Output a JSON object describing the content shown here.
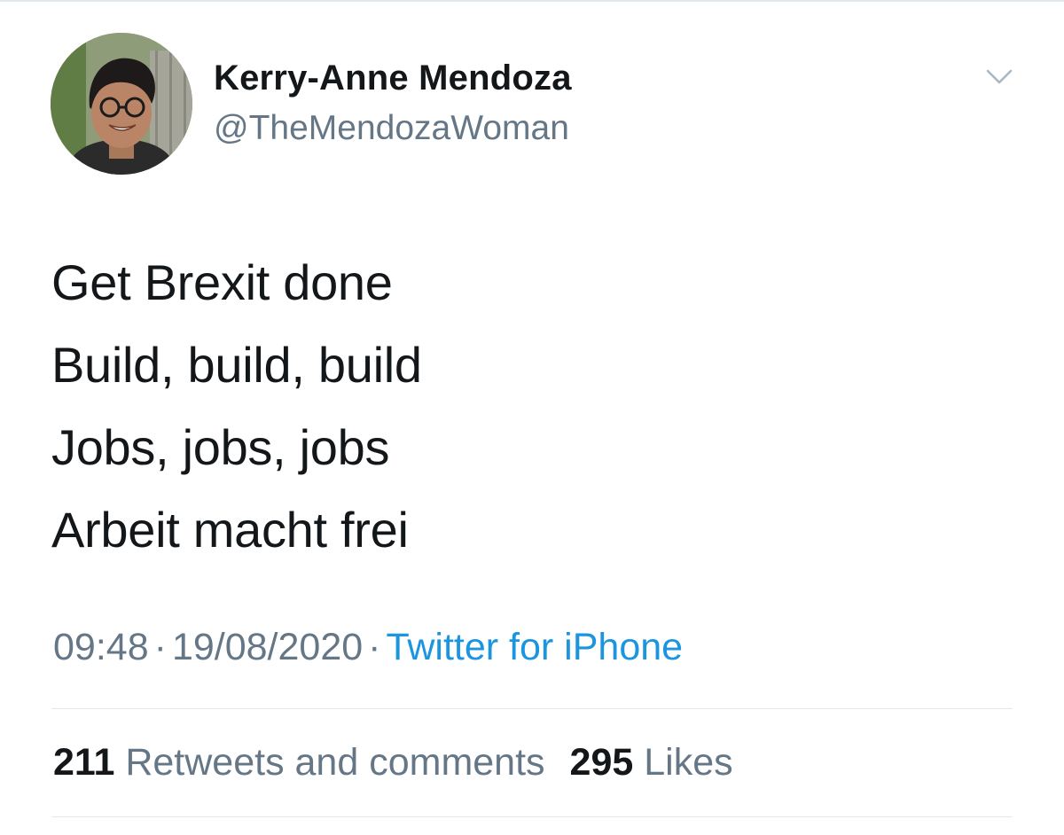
{
  "tweet": {
    "author": {
      "display_name": "Kerry-Anne Mendoza",
      "handle": "@TheMendozaWoman",
      "avatar_icon": "profile-photo"
    },
    "menu_icon": "chevron-down-icon",
    "lines": [
      "Get Brexit done",
      "Build, build, build",
      "Jobs, jobs, jobs",
      "Arbeit macht frei"
    ],
    "time": "09:48",
    "separator": "·",
    "date": "19/08/2020",
    "source": "Twitter for iPhone",
    "stats": {
      "retweets_count": "211",
      "retweets_label": "Retweets and comments",
      "likes_count": "295",
      "likes_label": "Likes"
    },
    "colors": {
      "text": "#14171a",
      "secondary": "#657786",
      "link": "#1b95e0",
      "divider": "#e1e8ed"
    }
  }
}
